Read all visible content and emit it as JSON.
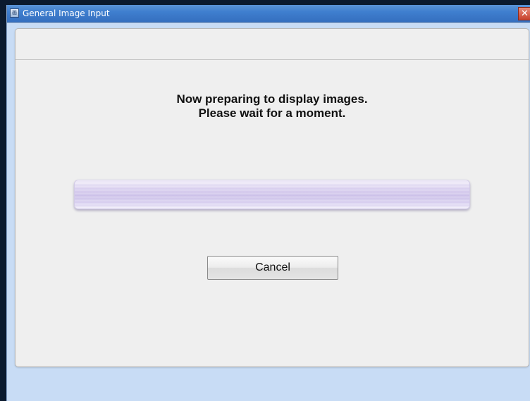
{
  "window": {
    "title": "General Image Input",
    "app_icon_glyph": "画",
    "close_glyph": "✕"
  },
  "message": {
    "line1": "Now preparing to display images.",
    "line2": "Please wait for a moment."
  },
  "progress": {
    "fraction": 1.0
  },
  "buttons": {
    "cancel_label": "Cancel"
  },
  "icons": {
    "app": "app-icon",
    "close": "close-icon"
  },
  "colors": {
    "titlebar": "#3f7fcf",
    "panel": "#efefef",
    "progress": "#cfc4ea",
    "close": "#c8412c"
  }
}
